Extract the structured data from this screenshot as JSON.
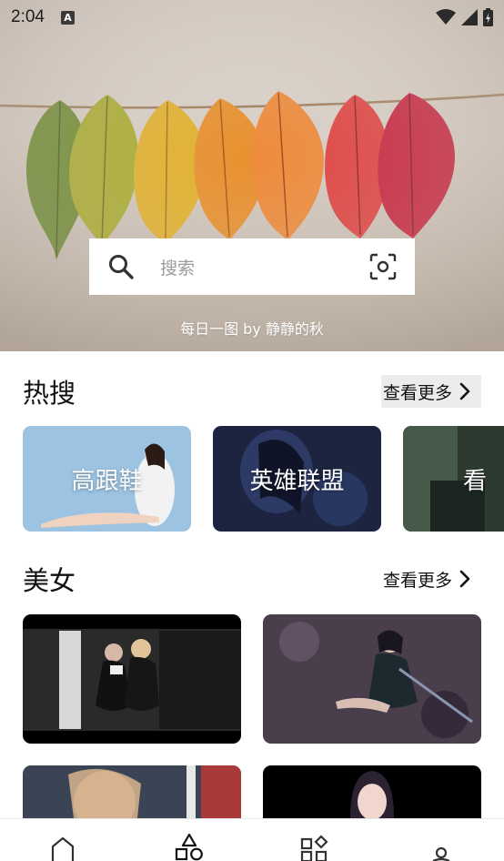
{
  "status_bar": {
    "time": "2:04",
    "notification_badge": "A"
  },
  "hero": {
    "search_placeholder": "搜索",
    "caption": "每日一图 by 静静的秋"
  },
  "hot": {
    "title": "热搜",
    "more_label": "查看更多",
    "cards": [
      {
        "label": "高跟鞋"
      },
      {
        "label": "英雄联盟"
      },
      {
        "label": "看"
      }
    ]
  },
  "beauty": {
    "title": "美女",
    "more_label": "查看更多"
  },
  "bottom_nav": {
    "items": [
      {
        "icon": "home-icon"
      },
      {
        "icon": "category-shapes-icon"
      },
      {
        "icon": "apps-icon"
      },
      {
        "icon": "profile-icon"
      }
    ]
  },
  "colors": {
    "background": "#ffffff",
    "text": "#111111",
    "placeholder": "#9b9b9b",
    "highlight": "#ececec"
  }
}
